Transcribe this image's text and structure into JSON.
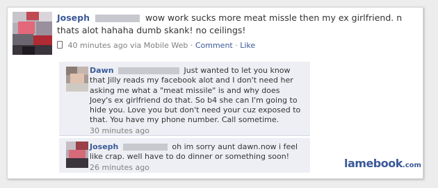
{
  "post": {
    "author": "Joseph",
    "text": "wow work sucks more meat missle then my ex girlfriend. n thats alot hahaha dumb skank! no ceilings!",
    "time": "40 minutes ago via Mobile Web",
    "separator": "·",
    "comment_link": "Comment",
    "like_link": "Like"
  },
  "comments": [
    {
      "author": "Dawn",
      "text": "Just wanted to let you know that Jilly reads my facebook alot and I don't need her asking me what a \"meat missile\" is and why does Joey's ex girlfriend do that. So b4 she can I'm going to hide you. Love you but don't need your cuz exposed to that. You have my phone number. Call sometime.",
      "time": "30 minutes ago"
    },
    {
      "author": "Joseph",
      "text": "oh im sorry aunt dawn.now i feel like crap. well have to do dinner or something soon!",
      "time": "26 minutes ago"
    }
  ],
  "watermark": {
    "brand": "lamebook",
    "tld": ".com",
    "color": "#3b5998"
  }
}
